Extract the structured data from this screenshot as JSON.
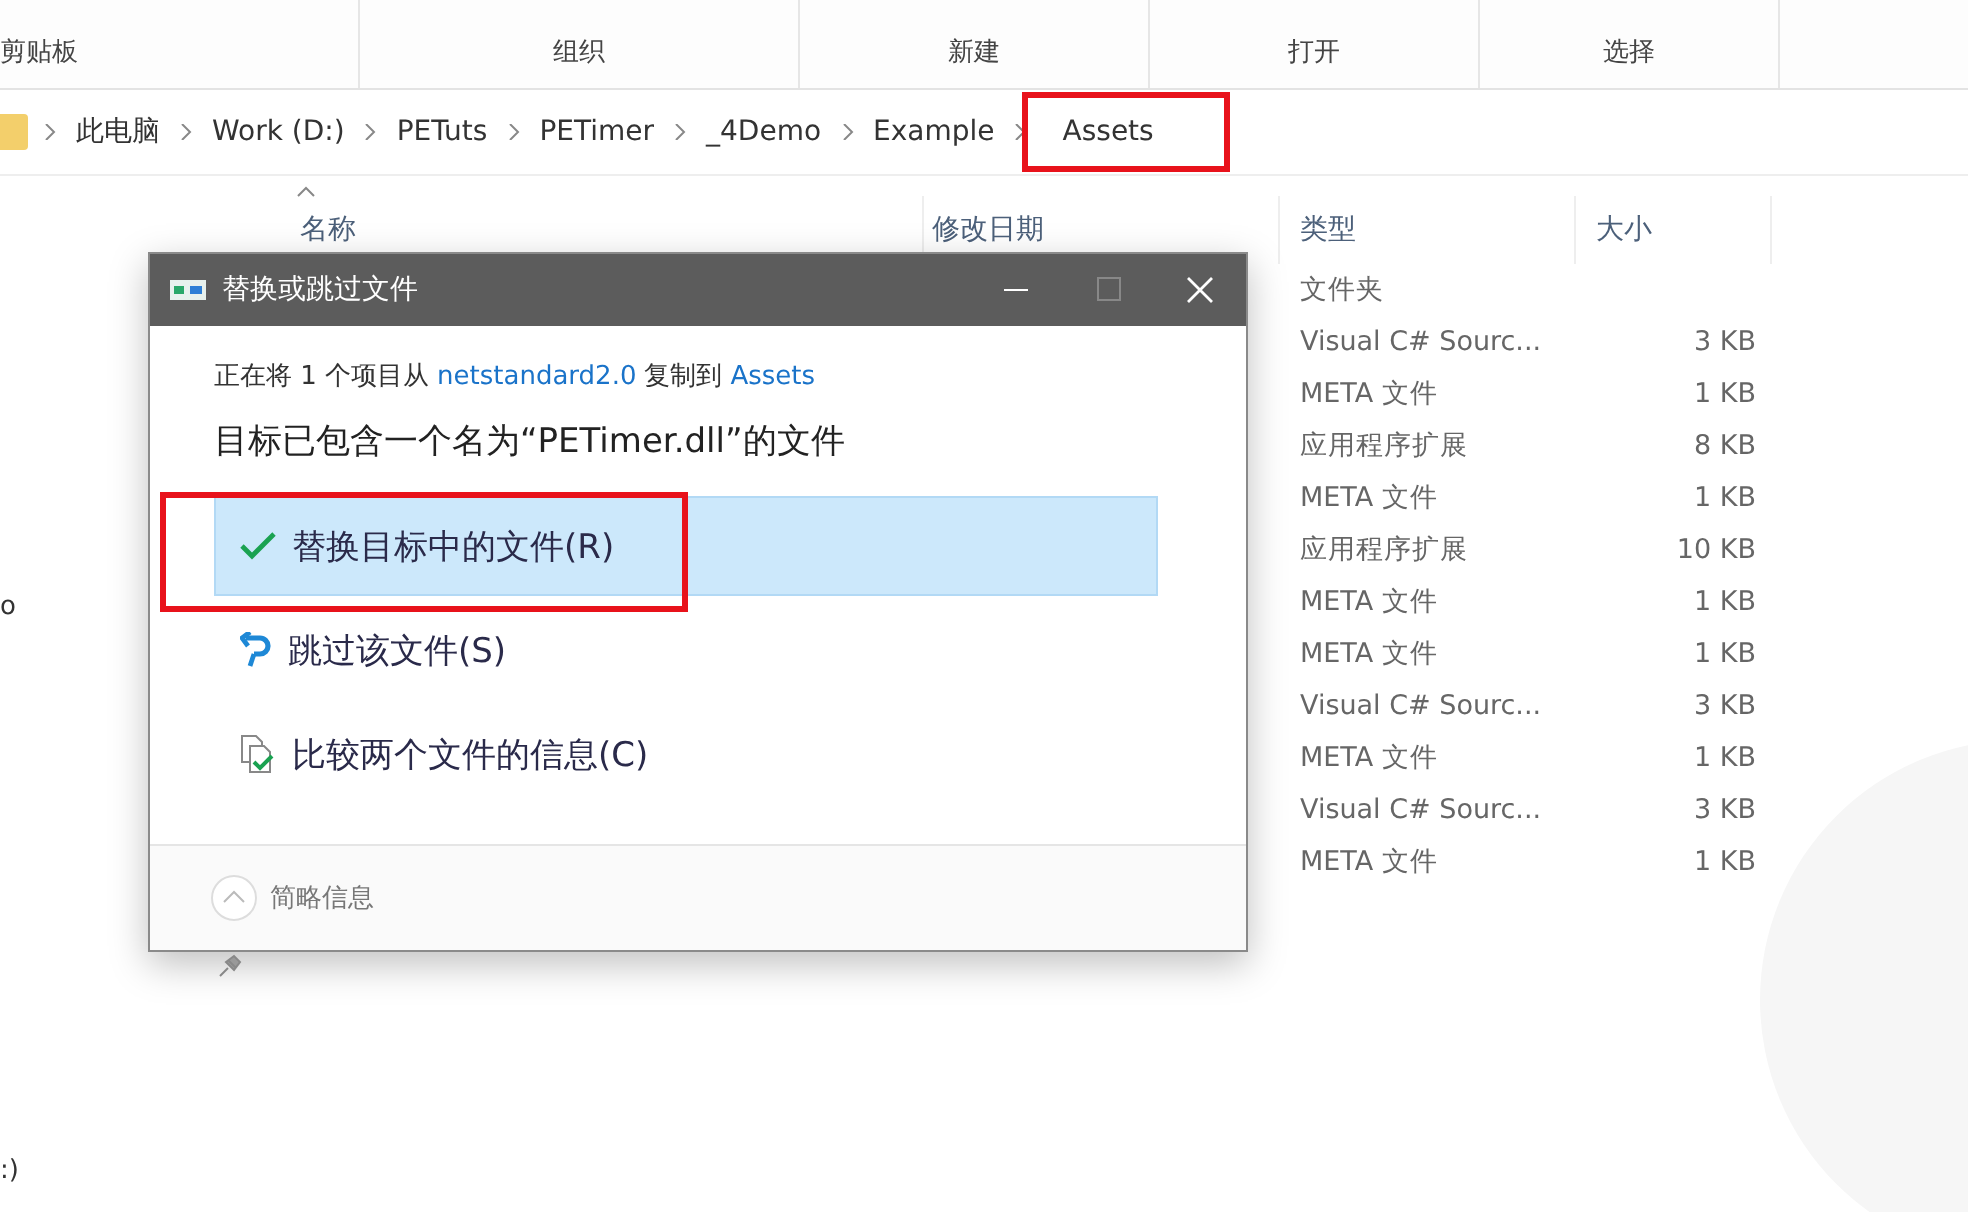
{
  "ribbon_groups": [
    "剪贴板",
    "组织",
    "新建",
    "打开",
    "选择"
  ],
  "breadcrumb": [
    {
      "label": "此电脑",
      "highlighted": false
    },
    {
      "label": "Work (D:)",
      "highlighted": false
    },
    {
      "label": "PETuts",
      "highlighted": false
    },
    {
      "label": "PETimer",
      "highlighted": false
    },
    {
      "label": "_4Demo",
      "highlighted": false
    },
    {
      "label": "Example",
      "highlighted": false
    },
    {
      "label": "Assets",
      "highlighted": true
    }
  ],
  "columns": [
    {
      "label": "名称",
      "sorted": true
    },
    {
      "label": "修改日期",
      "sorted": false
    },
    {
      "label": "类型",
      "sorted": false
    },
    {
      "label": "大小",
      "sorted": false
    }
  ],
  "rows": [
    {
      "type": "文件夹",
      "size": ""
    },
    {
      "type": "Visual C# Sourc...",
      "size": "3 KB"
    },
    {
      "type": "META 文件",
      "size": "1 KB"
    },
    {
      "type": "应用程序扩展",
      "size": "8 KB"
    },
    {
      "type": "META 文件",
      "size": "1 KB"
    },
    {
      "type": "应用程序扩展",
      "size": "10 KB"
    },
    {
      "type": "META 文件",
      "size": "1 KB"
    },
    {
      "type": "META 文件",
      "size": "1 KB"
    },
    {
      "type": "Visual C# Sourc...",
      "size": "3 KB"
    },
    {
      "type": "META 文件",
      "size": "1 KB"
    },
    {
      "type": "Visual C# Sourc...",
      "size": "3 KB"
    },
    {
      "type": "META 文件",
      "size": "1 KB"
    }
  ],
  "sidebar_fragments": [
    "o",
    ":)"
  ],
  "dialog": {
    "title": "替换或跳过文件",
    "copy_line": [
      {
        "kind": "text",
        "text": "正在将 1 个项目从"
      },
      {
        "kind": "link",
        "text": "netstandard2.0"
      },
      {
        "kind": "text",
        "text": "复制到"
      },
      {
        "kind": "link",
        "text": "Assets"
      }
    ],
    "headline": "目标已包含一个名为“PETimer.dll”的文件",
    "options": [
      {
        "kind": "replace",
        "label": "替换目标中的文件(R)",
        "selected": true,
        "highlighted": true
      },
      {
        "kind": "skip",
        "label": "跳过该文件(S)",
        "selected": false,
        "highlighted": false
      },
      {
        "kind": "compare",
        "label": "比较两个文件的信息(C)",
        "selected": false,
        "highlighted": false
      }
    ],
    "footer": "简略信息"
  }
}
